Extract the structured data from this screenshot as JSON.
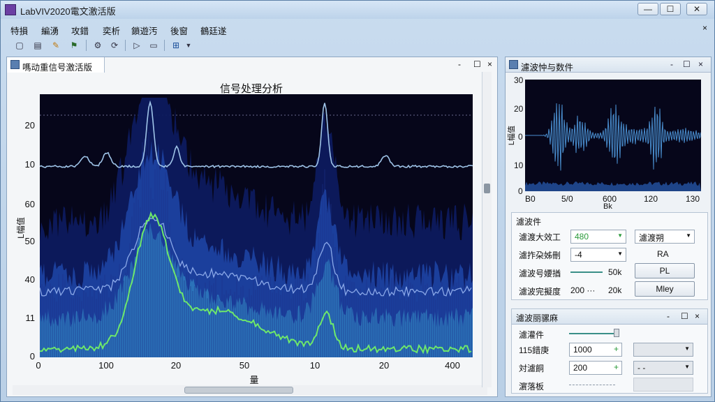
{
  "window": {
    "title": "LabVIV2020電文激活版",
    "minimize": "—",
    "maximize": "☐",
    "close": "✕"
  },
  "menu": {
    "items": [
      "特損",
      "編湧",
      "攻錯",
      "奕析",
      "鎖遊汚",
      "後窗",
      "鶴廷遂"
    ],
    "close": "×"
  },
  "toolbar": {
    "icons": [
      "new-file-icon",
      "open-icon",
      "pencil-icon",
      "flag-icon",
      "settings-icon",
      "cycle-icon",
      "forward-icon",
      "window-icon",
      "layout-icon"
    ]
  },
  "left_panel": {
    "title": "嗎动重信号激活版",
    "buttons": {
      "pin": "-",
      "maximize": "☐",
      "close": "×"
    },
    "chart_title": "信号处理分析",
    "y_axis_label": "L幅值",
    "x_axis_label": "量",
    "y_ticks": [
      "20",
      "10",
      "60",
      "50",
      "40",
      "11",
      "0"
    ],
    "x_ticks": [
      "0",
      "100",
      "20",
      "50",
      "10",
      "20",
      "400"
    ]
  },
  "right_panel": {
    "title": "濾波忡与数件",
    "buttons": {
      "pin": "-",
      "maximize": "☐",
      "close": "×"
    },
    "plot": {
      "y_ticks": [
        "30",
        "20",
        "0",
        "10",
        "0"
      ],
      "x_ticks": [
        "B0",
        "5/0",
        "600",
        "120",
        "130"
      ],
      "y_axis_label": "L幅值",
      "x_axis_label": "Bk"
    },
    "filter_group": {
      "title": "濾波件",
      "rows": [
        {
          "label": "濾渡大效工",
          "value": "480"
        },
        {
          "label": "濾拃朶姊刪",
          "value": "-4"
        },
        {
          "label": "濾波号婹揂",
          "value": "50k"
        },
        {
          "label": "濾波完擬度",
          "value": "20k",
          "value2": "200 ···"
        }
      ],
      "right_controls": {
        "select": "濾渡朔",
        "label": "RA",
        "btn1": "PL",
        "btn2": "Mley"
      }
    },
    "adj_group": {
      "title": "濾波丽骡麻",
      "buttons": {
        "pin": "-",
        "maximize": "☐",
        "close": "×"
      },
      "rows": [
        {
          "label": "濾灌件"
        },
        {
          "label": "115錯庚",
          "value": "1000",
          "step": "+",
          "select": ""
        },
        {
          "label": "対濾餇",
          "value": "200",
          "step": "+",
          "select": "- -"
        },
        {
          "label": "濵落板"
        }
      ]
    }
  },
  "colors": {
    "plot_bg": "#06061a",
    "spectrum_top": "#9fc4e8",
    "spectrum_green": "#6ee86a",
    "fill_blue": "#2a5fb8"
  }
}
